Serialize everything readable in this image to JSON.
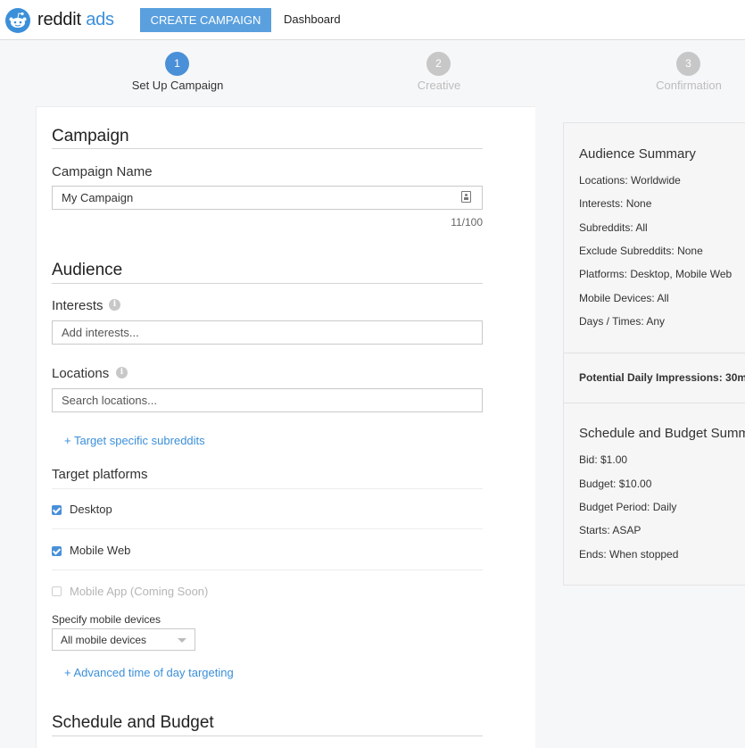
{
  "header": {
    "brand_part1": "reddit",
    "brand_part2": " ads",
    "create_campaign_label": "CREATE CAMPAIGN",
    "dashboard_label": "Dashboard"
  },
  "stepper": {
    "steps": [
      {
        "number": "1",
        "label": "Set Up Campaign",
        "active": true
      },
      {
        "number": "2",
        "label": "Creative",
        "active": false
      },
      {
        "number": "3",
        "label": "Confirmation",
        "active": false
      }
    ]
  },
  "campaign": {
    "title": "Campaign",
    "name_label": "Campaign Name",
    "name_value": "My Campaign",
    "char_count": "11/100"
  },
  "audience": {
    "title": "Audience",
    "interests_label": "Interests",
    "interests_placeholder": "Add interests...",
    "locations_label": "Locations",
    "locations_placeholder": "Search locations...",
    "target_subreddits_link": "+ Target specific subreddits",
    "platforms_label": "Target platforms",
    "platforms": [
      {
        "label": "Desktop",
        "checked": true,
        "disabled": false
      },
      {
        "label": "Mobile Web",
        "checked": true,
        "disabled": false
      },
      {
        "label": "Mobile App (Coming Soon)",
        "checked": false,
        "disabled": true
      }
    ],
    "devices_label": "Specify mobile devices",
    "devices_selected": "All mobile devices",
    "time_targeting_link": "+ Advanced time of day targeting"
  },
  "schedule": {
    "title": "Schedule and Budget"
  },
  "summary": {
    "audience_title": "Audience Summary",
    "audience_lines": [
      "Locations: Worldwide",
      "Interests: None",
      "Subreddits: All",
      "Exclude Subreddits: None",
      "Platforms: Desktop, Mobile Web",
      "Mobile Devices: All",
      "Days / Times: Any"
    ],
    "impressions": "Potential Daily Impressions: 30m",
    "schedule_title": "Schedule and Budget Summary",
    "schedule_lines": [
      "Bid: $1.00",
      "Budget: $10.00",
      "Budget Period: Daily",
      "Starts: ASAP",
      "Ends: When stopped"
    ]
  },
  "colors": {
    "accent": "#4a90d9",
    "button": "#5aa0de",
    "link": "#3b8fd9",
    "inactive_step": "#c7c7c7"
  }
}
